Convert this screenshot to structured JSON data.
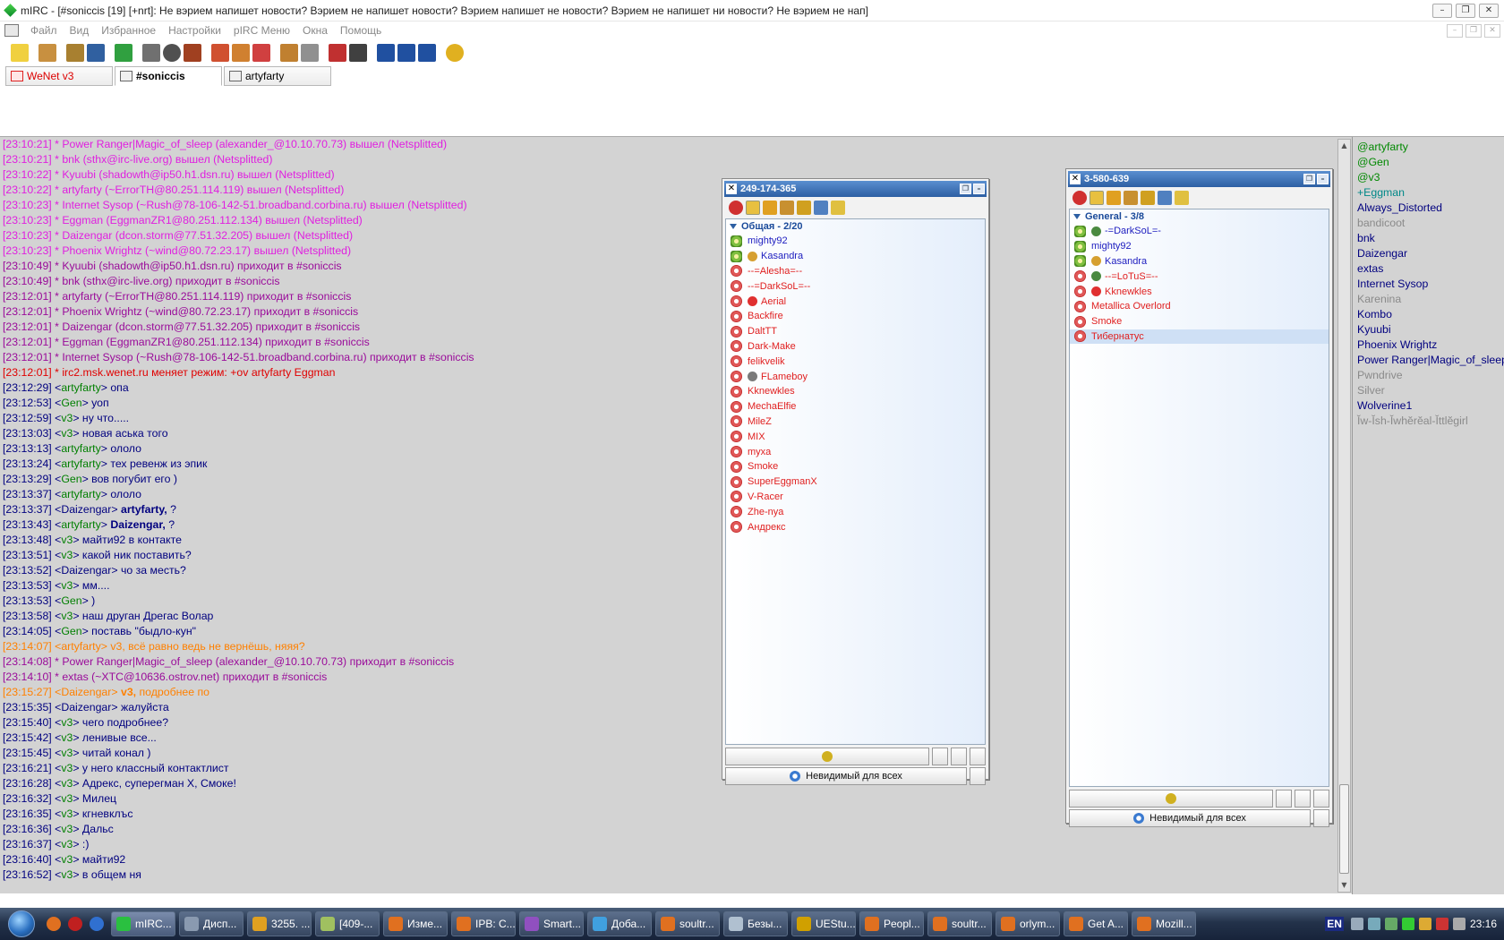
{
  "window": {
    "title": "mIRC - [#soniccis [19] [+nrt]: Не вэрием напишет новости? Вэрием не напишет новости? Вэрием напишет не новости? Вэрием не напишет ни новости? Не вэрием не нап]"
  },
  "menu": [
    "Файл",
    "Вид",
    "Избранное",
    "Настройки",
    "pIRC Меню",
    "Окна",
    "Помощь"
  ],
  "tabs": [
    {
      "label": "WeNet v3",
      "active": false
    },
    {
      "label": "#soniccis",
      "active": true
    },
    {
      "label": "artyfarty",
      "active": false
    }
  ],
  "log": [
    {
      "t": "[23:10:21]",
      "k": "quit",
      "text": "* Power Ranger|Magic_of_sleep (alexander_@10.10.70.73) вышел (Netsplitted)"
    },
    {
      "t": "[23:10:21]",
      "k": "quit",
      "text": "* bnk (sthx@irc-live.org) вышел (Netsplitted)"
    },
    {
      "t": "[23:10:22]",
      "k": "quit",
      "text": "* Kyuubi (shadowth@ip50.h1.dsn.ru) вышел (Netsplitted)"
    },
    {
      "t": "[23:10:22]",
      "k": "quit",
      "text": "* artyfarty (~ErrorTH@80.251.114.119) вышел (Netsplitted)"
    },
    {
      "t": "[23:10:23]",
      "k": "quit",
      "text": "* Internet Sysop (~Rush@78-106-142-51.broadband.corbina.ru) вышел (Netsplitted)"
    },
    {
      "t": "[23:10:23]",
      "k": "quit",
      "text": "* Eggman (EggmanZR1@80.251.112.134) вышел (Netsplitted)"
    },
    {
      "t": "[23:10:23]",
      "k": "quit",
      "text": "* Daizengar (dcon.storm@77.51.32.205) вышел (Netsplitted)"
    },
    {
      "t": "[23:10:23]",
      "k": "quit",
      "text": "* Phoenix Wrightz (~wind@80.72.23.17) вышел (Netsplitted)"
    },
    {
      "t": "[23:10:49]",
      "k": "join",
      "text": "* Kyuubi (shadowth@ip50.h1.dsn.ru) приходит в #soniccis"
    },
    {
      "t": "[23:10:49]",
      "k": "join",
      "text": "* bnk (sthx@irc-live.org) приходит в #soniccis"
    },
    {
      "t": "[23:12:01]",
      "k": "join",
      "text": "* artyfarty (~ErrorTH@80.251.114.119) приходит в #soniccis"
    },
    {
      "t": "[23:12:01]",
      "k": "join",
      "text": "* Phoenix Wrightz (~wind@80.72.23.17) приходит в #soniccis"
    },
    {
      "t": "[23:12:01]",
      "k": "join",
      "text": "* Daizengar (dcon.storm@77.51.32.205) приходит в #soniccis"
    },
    {
      "t": "[23:12:01]",
      "k": "join",
      "text": "* Eggman (EggmanZR1@80.251.112.134) приходит в #soniccis"
    },
    {
      "t": "[23:12:01]",
      "k": "join",
      "text": "* Internet Sysop (~Rush@78-106-142-51.broadband.corbina.ru) приходит в #soniccis"
    },
    {
      "t": "[23:12:01]",
      "k": "mode",
      "text": "* irc2.msk.wenet.ru меняет режим: +ov artyfarty Eggman"
    },
    {
      "t": "[23:12:29]",
      "k": "msg",
      "nick": "artyfarty",
      "nc": "a",
      "text": "опа"
    },
    {
      "t": "[23:12:53]",
      "k": "msg",
      "nick": "Gen",
      "nc": "a",
      "text": "уоп"
    },
    {
      "t": "[23:12:59]",
      "k": "msg",
      "nick": "v3",
      "nc": "a",
      "text": "ну что....."
    },
    {
      "t": "[23:13:03]",
      "k": "msg",
      "nick": "v3",
      "nc": "a",
      "text": "новая аська того"
    },
    {
      "t": "[23:13:13]",
      "k": "msg",
      "nick": "artyfarty",
      "nc": "a",
      "text": "ололо"
    },
    {
      "t": "[23:13:24]",
      "k": "msg",
      "nick": "artyfarty",
      "nc": "a",
      "text": "тех ревенж из эпик"
    },
    {
      "t": "[23:13:29]",
      "k": "msg",
      "nick": "Gen",
      "nc": "a",
      "text": "вов погубит его )"
    },
    {
      "t": "[23:13:37]",
      "k": "msg",
      "nick": "artyfarty",
      "nc": "a",
      "text": "ололо"
    },
    {
      "t": "[23:13:37]",
      "k": "msg",
      "nick": "Daizengar",
      "nc": "d",
      "bold": "artyfarty,",
      "text": " ?"
    },
    {
      "t": "[23:13:43]",
      "k": "msg",
      "nick": "artyfarty",
      "nc": "a",
      "bold": "Daizengar,",
      "text": " ?"
    },
    {
      "t": "[23:13:48]",
      "k": "msg",
      "nick": "v3",
      "nc": "a",
      "text": "майти92 в контакте"
    },
    {
      "t": "[23:13:51]",
      "k": "msg",
      "nick": "v3",
      "nc": "a",
      "text": "какой ник поставить?"
    },
    {
      "t": "[23:13:52]",
      "k": "msg",
      "nick": "Daizengar",
      "nc": "d",
      "text": "чо за месть?"
    },
    {
      "t": "[23:13:53]",
      "k": "msg",
      "nick": "v3",
      "nc": "a",
      "text": "мм...."
    },
    {
      "t": "[23:13:53]",
      "k": "msg",
      "nick": "Gen",
      "nc": "a",
      "text": ")"
    },
    {
      "t": "[23:13:58]",
      "k": "msg",
      "nick": "v3",
      "nc": "a",
      "text": "наш друган Дрегас Волар"
    },
    {
      "t": "[23:14:05]",
      "k": "msg",
      "nick": "Gen",
      "nc": "a",
      "text": "поставь \"быдло-кун\""
    },
    {
      "t": "[23:14:07]",
      "k": "hl",
      "nick": "artyfarty",
      "text": "v3, всё равно ведь не вернёшь, няяя?"
    },
    {
      "t": "[23:14:08]",
      "k": "join",
      "text": "* Power Ranger|Magic_of_sleep (alexander_@10.10.70.73) приходит в #soniccis"
    },
    {
      "t": "[23:14:10]",
      "k": "join",
      "text": "* extas (~XTC@10636.ostrov.net) приходит в #soniccis"
    },
    {
      "t": "[23:15:27]",
      "k": "hl",
      "nick": "Daizengar",
      "bold": "v3,",
      "text": " подробнее по"
    },
    {
      "t": "[23:15:35]",
      "k": "msg",
      "nick": "Daizengar",
      "nc": "d",
      "text": "жалуйста"
    },
    {
      "t": "[23:15:40]",
      "k": "msg",
      "nick": "v3",
      "nc": "a",
      "text": "чего подробнее?"
    },
    {
      "t": "[23:15:42]",
      "k": "msg",
      "nick": "v3",
      "nc": "a",
      "text": "ленивые все..."
    },
    {
      "t": "[23:15:45]",
      "k": "msg",
      "nick": "v3",
      "nc": "a",
      "text": "читай конал )"
    },
    {
      "t": "[23:16:21]",
      "k": "msg",
      "nick": "v3",
      "nc": "a",
      "text": "у него классный контактлист"
    },
    {
      "t": "[23:16:28]",
      "k": "msg",
      "nick": "v3",
      "nc": "a",
      "text": "Адрекс, суперегман Х, Смоке!"
    },
    {
      "t": "[23:16:32]",
      "k": "msg",
      "nick": "v3",
      "nc": "a",
      "text": "Милец"
    },
    {
      "t": "[23:16:35]",
      "k": "msg",
      "nick": "v3",
      "nc": "a",
      "text": "кгневклъс"
    },
    {
      "t": "[23:16:36]",
      "k": "msg",
      "nick": "v3",
      "nc": "a",
      "text": "Дальс"
    },
    {
      "t": "[23:16:37]",
      "k": "msg",
      "nick": "v3",
      "nc": "a",
      "text": ":)"
    },
    {
      "t": "[23:16:40]",
      "k": "msg",
      "nick": "v3",
      "nc": "a",
      "text": "майти92"
    },
    {
      "t": "[23:16:52]",
      "k": "msg",
      "nick": "v3",
      "nc": "a",
      "text": "в общем ня"
    }
  ],
  "nicklist": [
    {
      "name": "@artyfarty",
      "s": "op"
    },
    {
      "name": "@Gen",
      "s": "op"
    },
    {
      "name": "@v3",
      "s": "op"
    },
    {
      "name": "+Eggman",
      "s": "voice"
    },
    {
      "name": "Always_Distorted",
      "s": "reg"
    },
    {
      "name": "bandicoot",
      "s": "away"
    },
    {
      "name": "bnk",
      "s": "reg"
    },
    {
      "name": "Daizengar",
      "s": "reg"
    },
    {
      "name": "extas",
      "s": "reg"
    },
    {
      "name": "Internet Sysop",
      "s": "reg"
    },
    {
      "name": "Karenina",
      "s": "away"
    },
    {
      "name": "Kombo",
      "s": "reg"
    },
    {
      "name": "Kyuubi",
      "s": "reg"
    },
    {
      "name": "Phoenix Wrightz",
      "s": "reg"
    },
    {
      "name": "Power Ranger|Magic_of_sleep",
      "s": "reg"
    },
    {
      "name": "Pwndrive",
      "s": "away"
    },
    {
      "name": "Silver",
      "s": "away"
    },
    {
      "name": "Wolverine1",
      "s": "reg"
    },
    {
      "name": "Ĭw-Ĭsh-Ĭwhĕrĕal-Ĭttlĕgirl",
      "s": "away"
    }
  ],
  "icq1": {
    "title": "249-174-365",
    "group": "Общая - 2/20",
    "status_label": "Невидимый для всех",
    "contacts": [
      {
        "name": "mighty92",
        "s": "on"
      },
      {
        "name": "Kasandra",
        "s": "on",
        "badge": "#d6a030"
      },
      {
        "name": "--=Alesha=--",
        "s": "off"
      },
      {
        "name": "--=DarkSoL=--",
        "s": "off"
      },
      {
        "name": "Aerial",
        "s": "off",
        "badge": "#e03030"
      },
      {
        "name": "Backfire",
        "s": "off"
      },
      {
        "name": "DaltTT",
        "s": "off"
      },
      {
        "name": "Dark-Make",
        "s": "off"
      },
      {
        "name": "felikvelik",
        "s": "off"
      },
      {
        "name": "FLameboy",
        "s": "off",
        "badge": "#7a7a7a"
      },
      {
        "name": "Kknewkles",
        "s": "off"
      },
      {
        "name": "MechaElfie",
        "s": "off"
      },
      {
        "name": "MileZ",
        "s": "off"
      },
      {
        "name": "MIX",
        "s": "off"
      },
      {
        "name": "myxa",
        "s": "off"
      },
      {
        "name": "Smoke",
        "s": "off"
      },
      {
        "name": "SuperEggmanX",
        "s": "off"
      },
      {
        "name": "V-Racer",
        "s": "off"
      },
      {
        "name": "Zhe-nya",
        "s": "off"
      },
      {
        "name": "Андрекс",
        "s": "off"
      }
    ]
  },
  "icq2": {
    "title": "3-580-639",
    "group": "General - 3/8",
    "status_label": "Невидимый для всех",
    "contacts": [
      {
        "name": "-=DarkSoL=-",
        "s": "on",
        "badge": "#4a8a40"
      },
      {
        "name": "mighty92",
        "s": "on"
      },
      {
        "name": "Kasandra",
        "s": "on",
        "badge": "#d6a030"
      },
      {
        "name": "--=LoTuS=--",
        "s": "off",
        "badge": "#4a8a40"
      },
      {
        "name": "Kknewkles",
        "s": "off",
        "badge": "#e03030"
      },
      {
        "name": "Metallica Overlord",
        "s": "off"
      },
      {
        "name": "Smoke",
        "s": "off"
      },
      {
        "name": "Тибернатус",
        "s": "off",
        "sel": true
      }
    ]
  },
  "taskbar": {
    "tasks": [
      {
        "label": "mIRC...",
        "c": "#2ac040",
        "active": true
      },
      {
        "label": "Дисп...",
        "c": "#8a9ab0"
      },
      {
        "label": "3255. ...",
        "c": "#e0a020"
      },
      {
        "label": "[409-...",
        "c": "#a0c060"
      },
      {
        "label": "Изме...",
        "c": "#e07020"
      },
      {
        "label": "IPB: C...",
        "c": "#e07020"
      },
      {
        "label": "Smart...",
        "c": "#9050c0"
      },
      {
        "label": "Доба...",
        "c": "#40a0e0"
      },
      {
        "label": "soultr...",
        "c": "#e07020"
      },
      {
        "label": "Безы...",
        "c": "#b0c0d0"
      },
      {
        "label": "UEStu...",
        "c": "#d0a000"
      },
      {
        "label": "Peopl...",
        "c": "#e07020"
      },
      {
        "label": "soultr...",
        "c": "#e07020"
      },
      {
        "label": "orlym...",
        "c": "#e07020"
      },
      {
        "label": "Get A...",
        "c": "#e07020"
      },
      {
        "label": "Mozill...",
        "c": "#e07020"
      }
    ],
    "lang": "EN",
    "clock": "23:16"
  }
}
